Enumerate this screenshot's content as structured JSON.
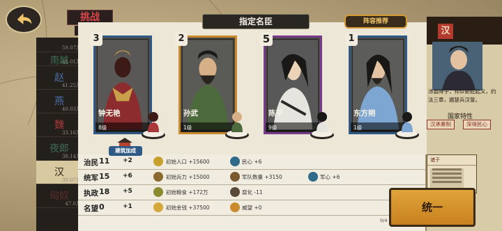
{
  "challenge_tag": "挑战",
  "dialog": {
    "title": "指定名臣",
    "lineup_button": "阵容推荐"
  },
  "cards": [
    {
      "order": "3",
      "name": "钟无艳",
      "level": "8级",
      "border": "#2f5a86"
    },
    {
      "order": "2",
      "name": "孙武",
      "level": "1级",
      "border": "#c88a2a"
    },
    {
      "order": "5",
      "name": "陈平",
      "level": "9级",
      "border": "#7b3b8c"
    },
    {
      "order": "1",
      "name": "东方朔",
      "level": "1级",
      "border": "#2f5a86"
    }
  ],
  "building_bonus": "建筑加成",
  "stats": [
    {
      "label": "治民",
      "value": "11",
      "bonus": "+2",
      "t1": "初始人口 +15600",
      "t2": "民心 +6"
    },
    {
      "label": "统军",
      "value": "15",
      "bonus": "+6",
      "t1": "初始兵力 +15000",
      "t2": "军队数量 +3150",
      "t3": "军心 +6"
    },
    {
      "label": "执政",
      "value": "18",
      "bonus": "+5",
      "t1": "初始粮食 +172万",
      "t2": "腐化 -11"
    },
    {
      "label": "名望",
      "value": "0",
      "bonus": "+1",
      "t1": "初始金钱 +37500",
      "t2": "威望 +0"
    }
  ],
  "unify_button": "统一",
  "page_indicator": "0/4",
  "nations": [
    {
      "name": "",
      "value": "59.07万"
    },
    {
      "name": "南越",
      "value": "45.01万"
    },
    {
      "name": "赵",
      "value": "41.25万"
    },
    {
      "name": "燕",
      "value": "40.03万"
    },
    {
      "name": "魏",
      "value": "33.16万"
    },
    {
      "name": "夜郎",
      "value": "38.14万"
    },
    {
      "name": "汉",
      "value": "30.07万"
    },
    {
      "name": "匈奴",
      "value": "47.0万"
    }
  ],
  "right_panel": {
    "flag": "汉",
    "text": "沛县降子，帅众斩蛇起义，约法三章，据楚兵汉誓。",
    "traits_label": "国家特性",
    "traits": [
      "汉承秦制",
      "深得民心"
    ],
    "card_title": "诸子"
  }
}
